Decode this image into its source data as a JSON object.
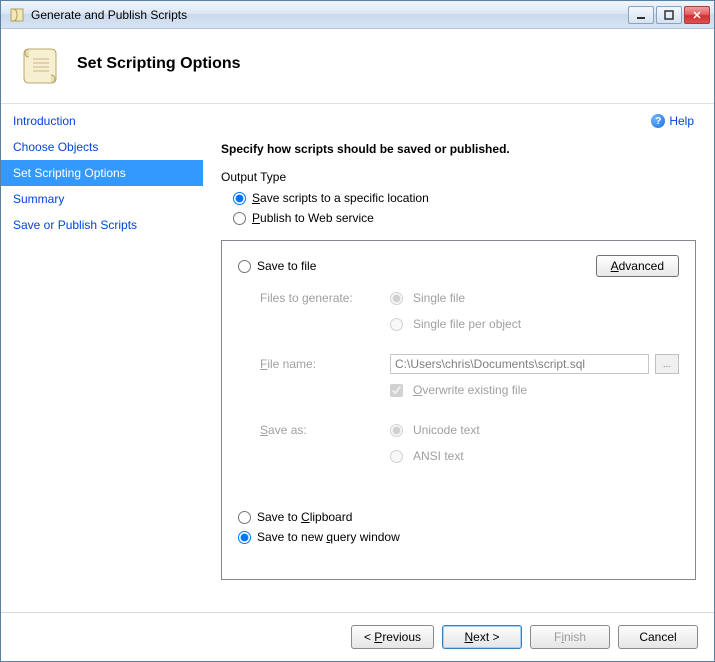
{
  "titlebar": {
    "title": "Generate and Publish Scripts"
  },
  "header": {
    "title": "Set Scripting Options"
  },
  "sidebar": {
    "items": [
      {
        "label": "Introduction"
      },
      {
        "label": "Choose Objects"
      },
      {
        "label": "Set Scripting Options"
      },
      {
        "label": "Summary"
      },
      {
        "label": "Save or Publish Scripts"
      }
    ]
  },
  "help": {
    "label": "Help"
  },
  "main": {
    "instruction": "Specify how scripts should be saved or published.",
    "output_type_label": "Output Type",
    "save_location": "Save scripts to a specific location",
    "publish_web": "Publish to Web service",
    "save_to_file": "Save to file",
    "advanced": "Advanced",
    "files_to_generate": "Files to generate:",
    "single_file": "Single file",
    "single_file_per_object": "Single file per object",
    "file_name_label": "File name:",
    "file_name_value": "C:\\Users\\chris\\Documents\\script.sql",
    "browse": "...",
    "overwrite": "Overwrite existing file",
    "save_as": "Save as:",
    "unicode": "Unicode text",
    "ansi": "ANSI text",
    "save_to_clipboard": "Save to Clipboard",
    "save_to_new_query": "Save to new query window"
  },
  "footer": {
    "previous": "< Previous",
    "next": "Next >",
    "finish": "Finish",
    "cancel": "Cancel"
  }
}
